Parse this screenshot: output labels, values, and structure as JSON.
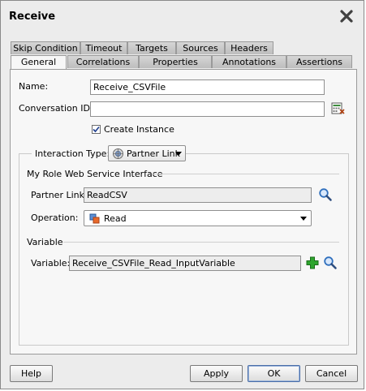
{
  "dialog": {
    "title": "Receive"
  },
  "tabs": {
    "row1": [
      "Skip Condition",
      "Timeout",
      "Targets",
      "Sources",
      "Headers"
    ],
    "row2": [
      "General",
      "Correlations",
      "Properties",
      "Annotations",
      "Assertions"
    ],
    "active": "General"
  },
  "general": {
    "name_label": "Name:",
    "name_value": "Receive_CSVFile",
    "conversation_label": "Conversation ID:",
    "conversation_value": "",
    "create_instance_label": "Create Instance",
    "create_instance_checked": true,
    "interaction_type_label": "Interaction Type:",
    "interaction_type_value": "Partner Link",
    "my_role_label": "My Role Web Service Interface",
    "partner_link_label": "Partner Link:",
    "partner_link_value": "ReadCSV",
    "operation_label": "Operation:",
    "operation_value": "Read",
    "variable_group_label": "Variable",
    "variable_label": "Variable:",
    "variable_value": "Receive_CSVFile_Read_InputVariable"
  },
  "buttons": {
    "help": "Help",
    "apply": "Apply",
    "ok": "OK",
    "cancel": "Cancel"
  },
  "icons": {
    "close": "close-x-icon",
    "conversation": "expression-builder-icon",
    "interaction": "partner-link-icon",
    "search": "magnifier-icon",
    "operation": "operation-icon",
    "add": "plus-icon"
  },
  "colors": {
    "add_green": "#1b8f1b",
    "search_blue": "#2f6fbd",
    "default_btn": "#4a6ea8"
  }
}
